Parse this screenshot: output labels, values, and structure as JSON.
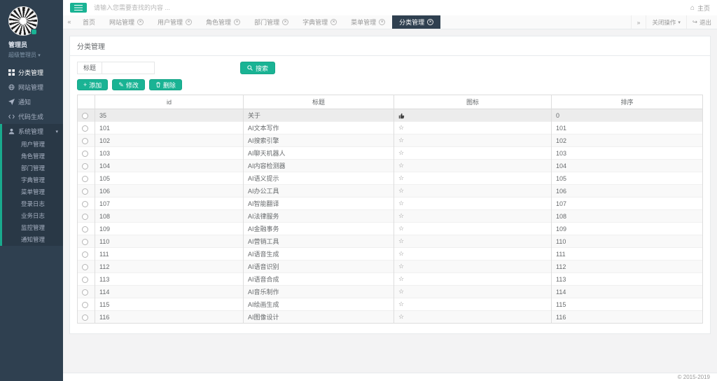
{
  "sidebar": {
    "user": {
      "name": "管理员",
      "role": "超级管理员"
    },
    "menu": [
      {
        "label": "分类管理",
        "icon": "grid-icon",
        "active": true
      },
      {
        "label": "网站管理",
        "icon": "globe-icon"
      },
      {
        "label": "通知",
        "icon": "send-icon"
      },
      {
        "label": "代码生成",
        "icon": "code-icon"
      },
      {
        "label": "系统管理",
        "icon": "user-icon",
        "expanded": true,
        "children": [
          "用户管理",
          "角色管理",
          "部门管理",
          "字典管理",
          "菜单管理",
          "登录日志",
          "业务日志",
          "监控管理",
          "通知管理"
        ]
      }
    ]
  },
  "topbar": {
    "search_placeholder": "请输入您需要查找的内容 ...",
    "home_label": "主页"
  },
  "tabbar": {
    "tabs": [
      {
        "label": "首页",
        "closable": false,
        "active": false
      },
      {
        "label": "网站管理",
        "closable": true,
        "active": false
      },
      {
        "label": "用户管理",
        "closable": true,
        "active": false
      },
      {
        "label": "角色管理",
        "closable": true,
        "active": false
      },
      {
        "label": "部门管理",
        "closable": true,
        "active": false
      },
      {
        "label": "字典管理",
        "closable": true,
        "active": false
      },
      {
        "label": "菜单管理",
        "closable": true,
        "active": false
      },
      {
        "label": "分类管理",
        "closable": true,
        "active": true
      }
    ],
    "close_actions_label": "关闭操作",
    "logout_label": "退出"
  },
  "panel": {
    "title": "分类管理",
    "search": {
      "label": "标题",
      "value": "",
      "button": "搜索"
    },
    "actions": [
      {
        "label": "添加",
        "icon": "plus"
      },
      {
        "label": "修改",
        "icon": "pencil"
      },
      {
        "label": "删除",
        "icon": "trash"
      }
    ],
    "table": {
      "columns": [
        "id",
        "标题",
        "图标",
        "排序"
      ],
      "rows": [
        {
          "id": "35",
          "title": "关于",
          "icon": "thumbs-up",
          "sort": "0"
        },
        {
          "id": "101",
          "title": "AI文本写作",
          "icon": "star",
          "sort": "101"
        },
        {
          "id": "102",
          "title": "AI搜索引擎",
          "icon": "star",
          "sort": "102"
        },
        {
          "id": "103",
          "title": "AI聊天机器人",
          "icon": "star",
          "sort": "103"
        },
        {
          "id": "104",
          "title": "AI内容检测器",
          "icon": "star",
          "sort": "104"
        },
        {
          "id": "105",
          "title": "AI语义提示",
          "icon": "star",
          "sort": "105"
        },
        {
          "id": "106",
          "title": "AI办公工具",
          "icon": "star",
          "sort": "106"
        },
        {
          "id": "107",
          "title": "AI智能翻译",
          "icon": "star",
          "sort": "107"
        },
        {
          "id": "108",
          "title": "AI法律服务",
          "icon": "star",
          "sort": "108"
        },
        {
          "id": "109",
          "title": "AI金融事务",
          "icon": "star",
          "sort": "109"
        },
        {
          "id": "110",
          "title": "AI营销工具",
          "icon": "star",
          "sort": "110"
        },
        {
          "id": "111",
          "title": "AI语音生成",
          "icon": "star",
          "sort": "111"
        },
        {
          "id": "112",
          "title": "AI语音识别",
          "icon": "star",
          "sort": "112"
        },
        {
          "id": "113",
          "title": "AI语音合成",
          "icon": "star",
          "sort": "113"
        },
        {
          "id": "114",
          "title": "AI音乐制作",
          "icon": "star",
          "sort": "114"
        },
        {
          "id": "115",
          "title": "AI绘画生成",
          "icon": "star",
          "sort": "115"
        },
        {
          "id": "116",
          "title": "AI图像设计",
          "icon": "star",
          "sort": "116"
        }
      ]
    }
  },
  "footer": {
    "copyright": "© 2015-2019"
  },
  "icons": {
    "star": "☆",
    "plus": "+",
    "pencil": "✎",
    "home": "⌂",
    "back": "«",
    "forward": "»",
    "caret": "▾",
    "logout": "↪"
  },
  "colors": {
    "accent": "#1ab394",
    "sidebar": "#2f4050",
    "sidebar_expanded": "#293846",
    "stripe": "#19aa8d",
    "tab_active": "#2f4050"
  }
}
